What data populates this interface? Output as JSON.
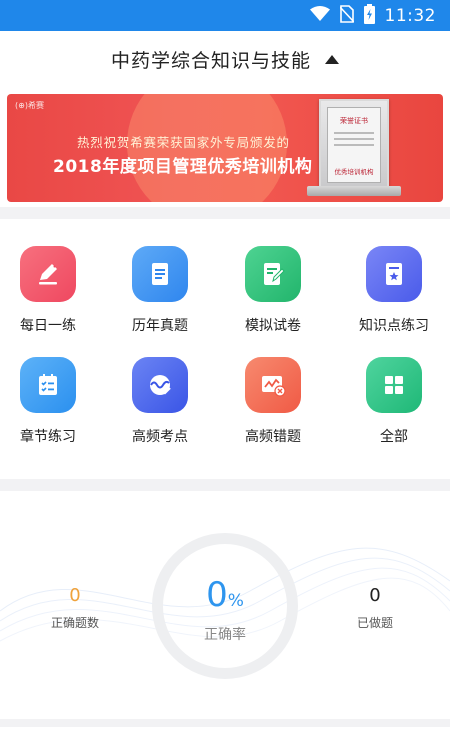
{
  "status_bar": {
    "time": "11:32",
    "icons": [
      "wifi-icon",
      "no-sim-icon",
      "battery-charging-icon"
    ]
  },
  "header": {
    "title": "中药学综合知识与技能",
    "dropdown_icon": "caret-up-icon"
  },
  "banner": {
    "brand": "(⊕)希赛",
    "line1": "热烈祝贺希赛荣获国家外专局颁发的",
    "line2": "2018年度项目管理优秀培训机构",
    "certificate_title": "荣誉证书",
    "certificate_text": "优秀培训机构"
  },
  "features": [
    {
      "label": "每日一练",
      "icon": "pencil-icon",
      "color": "#f2596a"
    },
    {
      "label": "历年真题",
      "icon": "document-icon",
      "color": "#3e95f2"
    },
    {
      "label": "模拟试卷",
      "icon": "exam-paper-icon",
      "color": "#31c27c"
    },
    {
      "label": "知识点练习",
      "icon": "star-card-icon",
      "color": "#5b6cf0"
    },
    {
      "label": "章节练习",
      "icon": "checklist-icon",
      "color": "#3ea0f5"
    },
    {
      "label": "高频考点",
      "icon": "wave-check-icon",
      "color": "#4e6bf0"
    },
    {
      "label": "高频错题",
      "icon": "trend-error-icon",
      "color": "#f36b55"
    },
    {
      "label": "全部",
      "icon": "grid-icon",
      "color": "#2fc488"
    }
  ],
  "stats": {
    "correct_count": {
      "value": "0",
      "label": "正确题数",
      "color": "#f0a23a"
    },
    "accuracy": {
      "value": "0",
      "unit": "%",
      "label": "正确率"
    },
    "done_count": {
      "value": "0",
      "label": "已做题",
      "color": "#222222"
    }
  }
}
